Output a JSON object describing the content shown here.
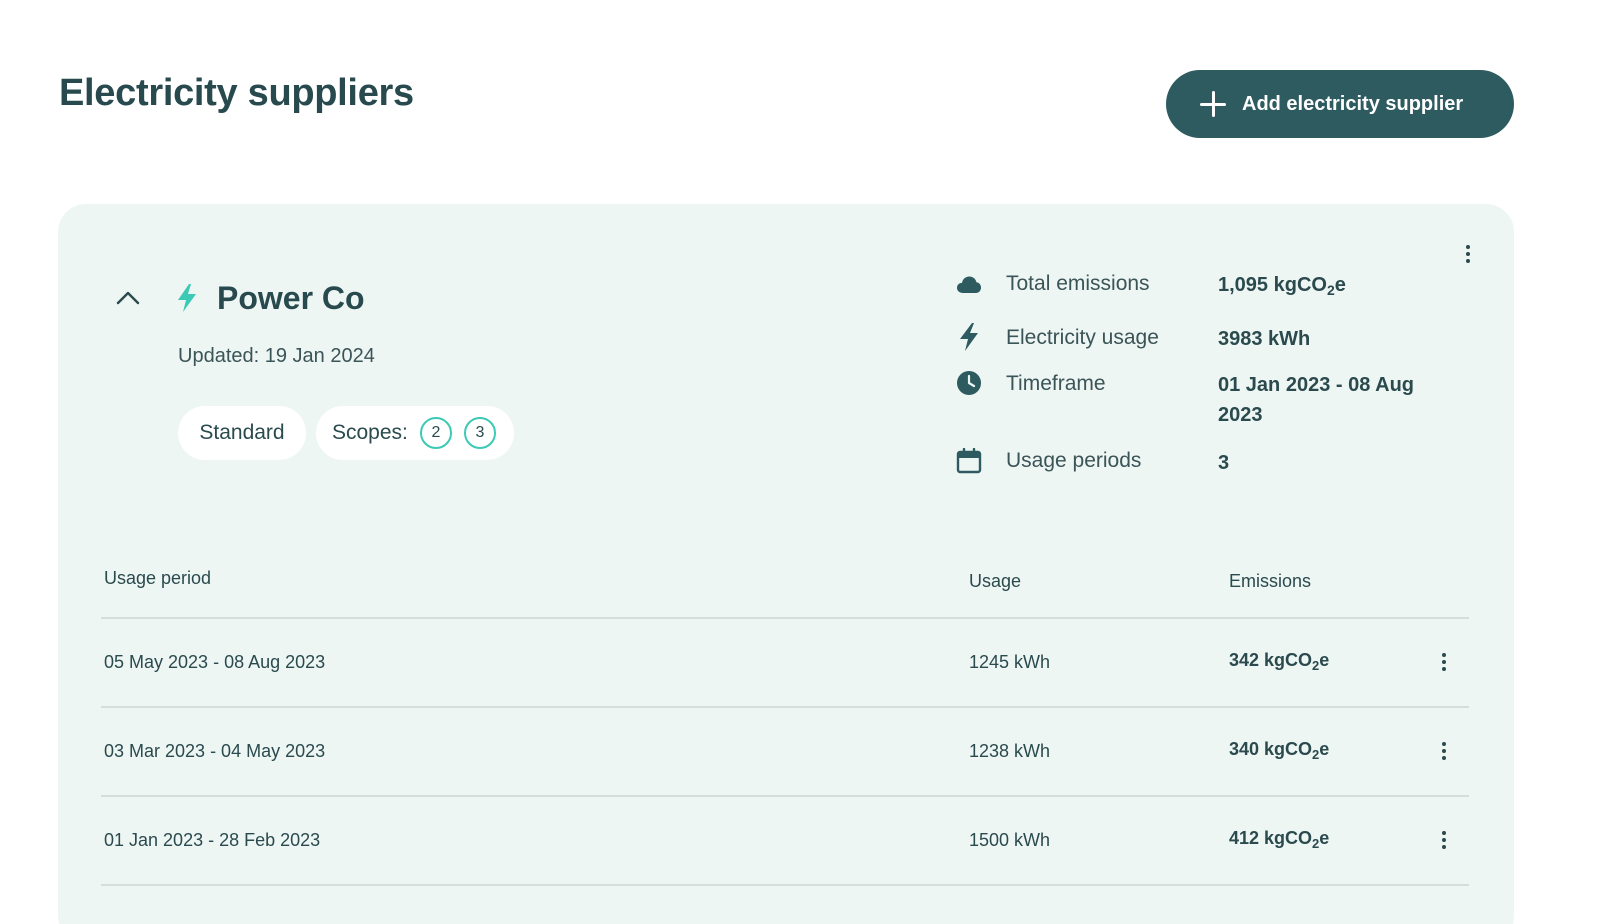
{
  "page": {
    "title": "Electricity suppliers",
    "add_button_label": "Add electricity supplier"
  },
  "supplier": {
    "name": "Power Co",
    "updated": "Updated: 19 Jan 2024",
    "tag_standard": "Standard",
    "scopes_label": "Scopes:",
    "scopes": [
      "2",
      "3"
    ],
    "stats": {
      "total_emissions_label": "Total emissions",
      "total_emissions_value": "1,095 kgCO",
      "electricity_usage_label": "Electricity usage",
      "electricity_usage_value": "3983 kWh",
      "timeframe_label": "Timeframe",
      "timeframe_value_line1": "01 Jan 2023 - 08 Aug",
      "timeframe_value_line2": "2023",
      "usage_periods_label": "Usage periods",
      "usage_periods_value": "3"
    }
  },
  "table": {
    "headers": {
      "period": "Usage period",
      "usage": "Usage",
      "emissions": "Emissions"
    },
    "rows": [
      {
        "period": "05 May 2023 - 08 Aug 2023",
        "usage": "1245 kWh",
        "emissions": "342 kgCO"
      },
      {
        "period": "03 Mar 2023 - 04 May 2023",
        "usage": "1238 kWh",
        "emissions": "340 kgCO"
      },
      {
        "period": "01 Jan 2023 - 28 Feb 2023",
        "usage": "1500 kWh",
        "emissions": "412 kgCO"
      }
    ],
    "co2_subscript": "2",
    "co2_suffix": "e"
  },
  "colors": {
    "primary": "#2d5b60",
    "accent": "#3cc9b5",
    "card_bg": "#eef6f4"
  },
  "icons": {
    "add": "plus-icon",
    "collapse": "chevron-up-icon",
    "supplier": "lightning-bolt-icon",
    "emissions": "cloud-icon",
    "usage": "lightning-bolt-icon",
    "timeframe": "clock-icon",
    "periods": "calendar-icon",
    "menu": "more-vertical-icon"
  }
}
